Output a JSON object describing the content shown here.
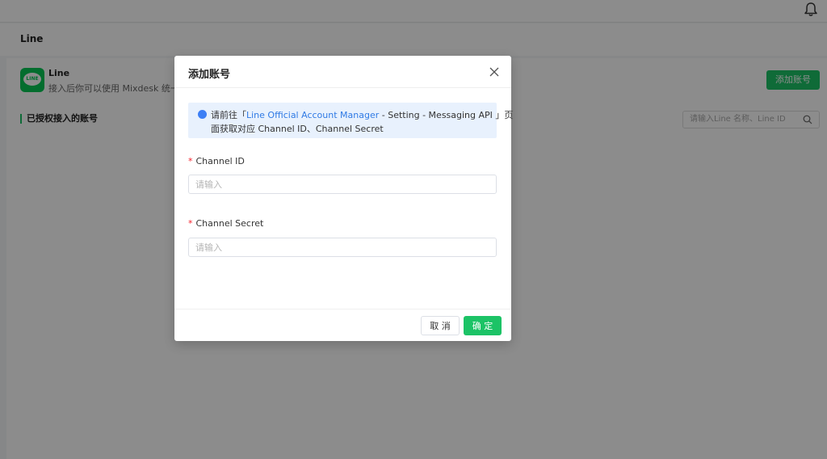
{
  "page": {
    "title": "Line",
    "integration_name": "Line",
    "integration_desc": "接入后你可以使用 Mixdesk 统一接",
    "logo_text": "LINE",
    "add_button": "添加账号",
    "section_title": "已授权接入的账号",
    "search_placeholder": "请输入Line 名称、Line ID"
  },
  "modal": {
    "title": "添加账号",
    "notice_prefix": "请前往「",
    "notice_link": "Line Official Account Manager",
    "notice_suffix": " - Setting - Messaging API 」页",
    "notice_line2": "面获取对应 Channel ID、Channel Secret",
    "fields": [
      {
        "label": "Channel ID",
        "placeholder": "请输入",
        "required": true
      },
      {
        "label": "Channel Secret",
        "placeholder": "请输入",
        "required": true
      }
    ],
    "cancel_label": "取 消",
    "ok_label": "确 定"
  },
  "colors": {
    "brand_green": "#1cc366",
    "link_blue": "#2f7ae5",
    "notice_bg": "#e8f1fd",
    "required_red": "#f5222d"
  },
  "icons": [
    "bell-icon",
    "line-logo-icon",
    "search-icon",
    "info-icon",
    "close-icon"
  ]
}
